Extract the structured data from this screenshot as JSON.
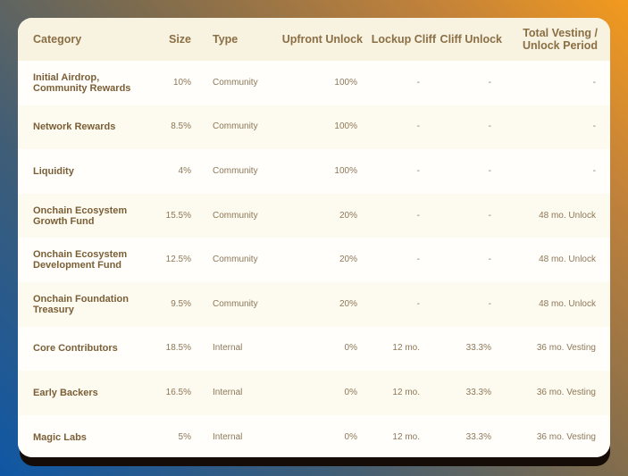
{
  "headers": {
    "category": "Category",
    "size": "Size",
    "type": "Type",
    "upfront": "Upfront Unlock",
    "lockup": "Lockup Cliff",
    "cliff": "Cliff Unlock",
    "total_line1": "Total Vesting /",
    "total_line2": "Unlock Period"
  },
  "rows": [
    {
      "category": [
        "Initial Airdrop,",
        "Community Rewards"
      ],
      "size": "10%",
      "type": "Community",
      "upfront": "100%",
      "lockup": "-",
      "cliff": "-",
      "total": "-"
    },
    {
      "category": [
        "Network Rewards",
        ""
      ],
      "size": "8.5%",
      "type": "Community",
      "upfront": "100%",
      "lockup": "-",
      "cliff": "-",
      "total": "-"
    },
    {
      "category": [
        "Liquidity",
        ""
      ],
      "size": "4%",
      "type": "Community",
      "upfront": "100%",
      "lockup": "-",
      "cliff": "-",
      "total": "-"
    },
    {
      "category": [
        "Onchain Ecosystem",
        "Growth Fund"
      ],
      "size": "15.5%",
      "type": "Community",
      "upfront": "20%",
      "lockup": "-",
      "cliff": "-",
      "total": "48 mo. Unlock"
    },
    {
      "category": [
        "Onchain Ecosystem",
        "Development Fund"
      ],
      "size": "12.5%",
      "type": "Community",
      "upfront": "20%",
      "lockup": "-",
      "cliff": "-",
      "total": "48 mo. Unlock"
    },
    {
      "category": [
        "Onchain Foundation",
        "Treasury"
      ],
      "size": "9.5%",
      "type": "Community",
      "upfront": "20%",
      "lockup": "-",
      "cliff": "-",
      "total": "48 mo. Unlock"
    },
    {
      "category": [
        "Core Contributors",
        ""
      ],
      "size": "18.5%",
      "type": "Internal",
      "upfront": "0%",
      "lockup": "12 mo.",
      "cliff": "33.3%",
      "total": "36 mo. Vesting"
    },
    {
      "category": [
        "Early Backers",
        ""
      ],
      "size": "16.5%",
      "type": "Internal",
      "upfront": "0%",
      "lockup": "12 mo.",
      "cliff": "33.3%",
      "total": "36 mo. Vesting"
    },
    {
      "category": [
        "Magic Labs",
        ""
      ],
      "size": "5%",
      "type": "Internal",
      "upfront": "0%",
      "lockup": "12 mo.",
      "cliff": "33.3%",
      "total": "36 mo. Vesting"
    }
  ]
}
